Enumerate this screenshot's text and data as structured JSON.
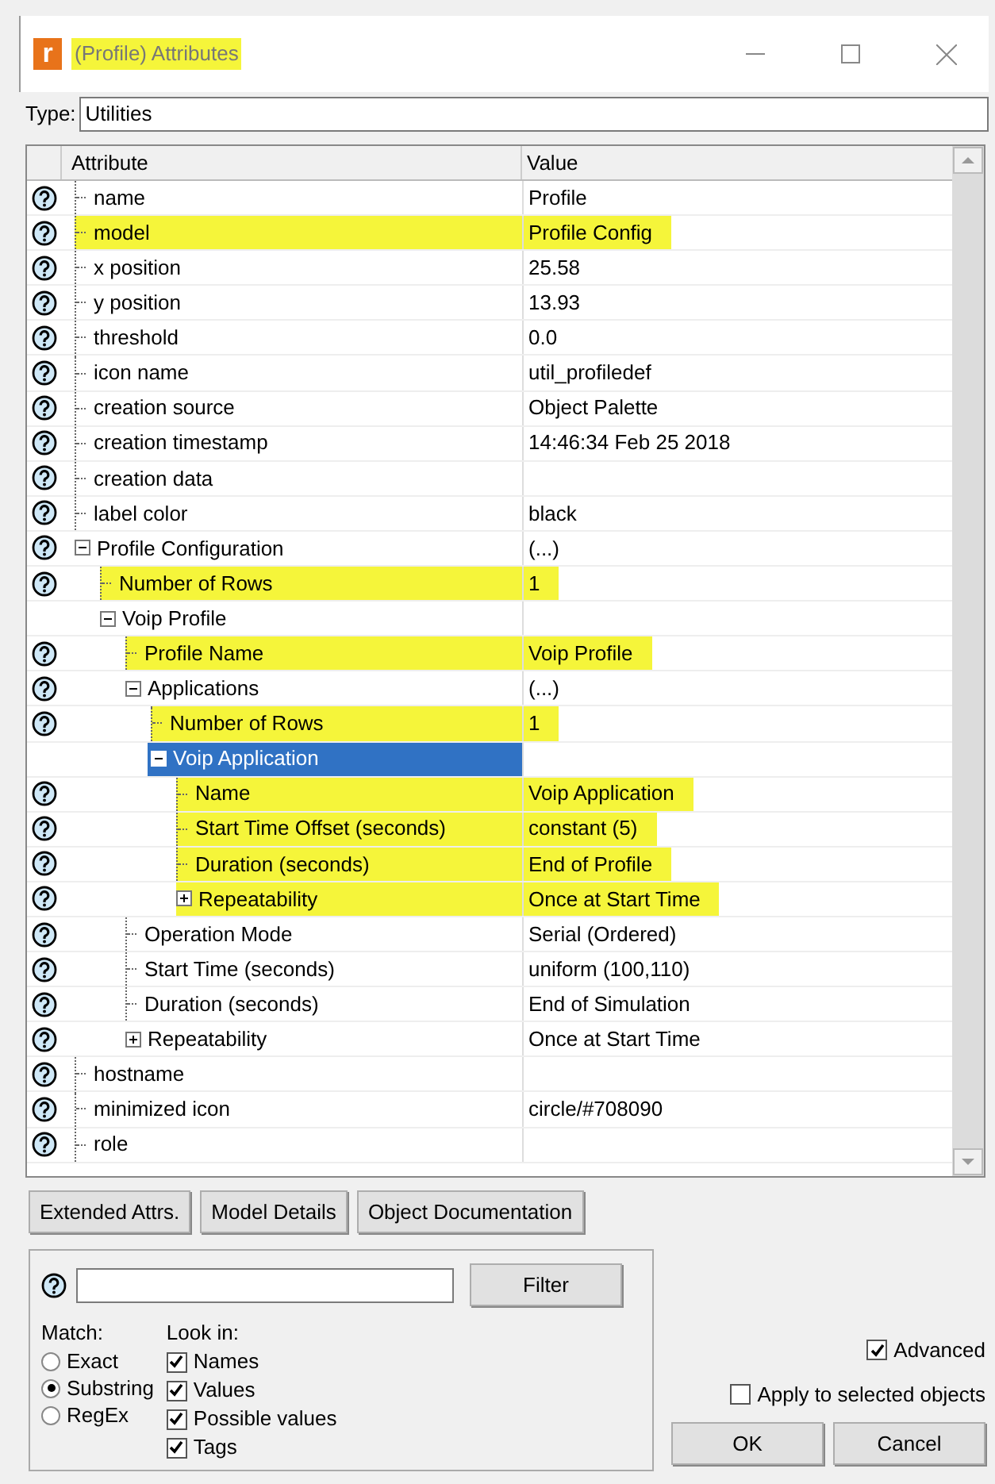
{
  "window": {
    "icon_letter": "r",
    "title": "(Profile) Attributes",
    "title_highlighted": true
  },
  "type": {
    "label": "Type:",
    "value": "Utilities"
  },
  "grid": {
    "columns": [
      "Attribute",
      "Value"
    ],
    "rows": [
      {
        "name": "name",
        "value": "Profile",
        "help": true,
        "highlighted": false,
        "selected": false
      },
      {
        "name": "model",
        "value": "Profile Config",
        "help": true,
        "highlighted": true,
        "selected": false
      },
      {
        "name": "x position",
        "value": "25.58",
        "help": true,
        "highlighted": false,
        "selected": false
      },
      {
        "name": "y position",
        "value": "13.93",
        "help": true,
        "highlighted": false,
        "selected": false
      },
      {
        "name": "threshold",
        "value": "0.0",
        "help": true,
        "highlighted": false,
        "selected": false
      },
      {
        "name": "icon name",
        "value": "util_profiledef",
        "help": true,
        "highlighted": false,
        "selected": false
      },
      {
        "name": "creation source",
        "value": "Object Palette",
        "help": true,
        "highlighted": false,
        "selected": false
      },
      {
        "name": "creation timestamp",
        "value": "14:46:34 Feb 25 2018",
        "help": true,
        "highlighted": false,
        "selected": false
      },
      {
        "name": "creation data",
        "help": true,
        "highlighted": false,
        "selected": false
      },
      {
        "name": "label color",
        "value": "black",
        "help": true,
        "highlighted": false,
        "selected": false
      },
      {
        "name": "Profile Configuration",
        "value": "(...)",
        "help": true,
        "highlighted": false,
        "selected": false,
        "expanded": true,
        "children": [
          {
            "name": "Number of Rows",
            "value": "1",
            "help": true,
            "highlighted": true,
            "selected": false
          },
          {
            "name": "Voip Profile",
            "help": false,
            "highlighted": false,
            "selected": false,
            "expanded": true,
            "children": [
              {
                "name": "Profile Name",
                "value": "Voip Profile",
                "help": true,
                "highlighted": true,
                "selected": false
              },
              {
                "name": "Applications",
                "value": "(...)",
                "help": true,
                "highlighted": false,
                "selected": false,
                "expanded": true,
                "children": [
                  {
                    "name": "Number of Rows",
                    "value": "1",
                    "help": true,
                    "highlighted": true,
                    "selected": false
                  },
                  {
                    "name": "Voip Application",
                    "help": false,
                    "highlighted": false,
                    "selected": true,
                    "expanded": true,
                    "children": [
                      {
                        "name": "Name",
                        "value": "Voip Application",
                        "help": true,
                        "highlighted": true,
                        "selected": false
                      },
                      {
                        "name": "Start Time Offset (seconds)",
                        "value": "constant (5)",
                        "help": true,
                        "highlighted": true,
                        "selected": false
                      },
                      {
                        "name": "Duration (seconds)",
                        "value": "End of Profile",
                        "help": true,
                        "highlighted": true,
                        "selected": false
                      },
                      {
                        "name": "Repeatability",
                        "value": "Once at Start Time",
                        "help": true,
                        "highlighted": true,
                        "selected": false,
                        "expanded": false
                      }
                    ]
                  }
                ]
              },
              {
                "name": "Operation Mode",
                "value": "Serial (Ordered)",
                "help": true,
                "highlighted": false,
                "selected": false
              },
              {
                "name": "Start Time (seconds)",
                "value": "uniform (100,110)",
                "help": true,
                "highlighted": false,
                "selected": false
              },
              {
                "name": "Duration (seconds)",
                "value": "End of Simulation",
                "help": true,
                "highlighted": false,
                "selected": false
              },
              {
                "name": "Repeatability",
                "value": "Once at Start Time",
                "help": true,
                "highlighted": false,
                "selected": false,
                "expanded": false
              }
            ]
          }
        ]
      },
      {
        "name": "hostname",
        "help": true,
        "highlighted": false,
        "selected": false
      },
      {
        "name": "minimized icon",
        "value": "circle/#708090",
        "help": true,
        "highlighted": false,
        "selected": false
      },
      {
        "name": "role",
        "help": true,
        "highlighted": false,
        "selected": false
      }
    ]
  },
  "buttons": [
    "Extended Attrs.",
    "Model Details",
    "Object Documentation"
  ],
  "filter": {
    "button": "Filter",
    "match_label": "Match:",
    "match_options": [
      {
        "label": "Exact",
        "selected": false
      },
      {
        "label": "Substring",
        "selected": true
      },
      {
        "label": "RegEx",
        "selected": false
      }
    ],
    "look_in_label": "Look in:",
    "look_in": [
      {
        "label": "Names",
        "checked": true
      },
      {
        "label": "Values",
        "checked": true
      },
      {
        "label": "Possible values",
        "checked": true
      },
      {
        "label": "Tags",
        "checked": true
      }
    ]
  },
  "advanced": {
    "label": "Advanced",
    "checked": true
  },
  "apply_selected": {
    "label": "Apply to selected objects",
    "checked": false
  },
  "dialog_buttons": [
    "OK",
    "Cancel"
  ]
}
